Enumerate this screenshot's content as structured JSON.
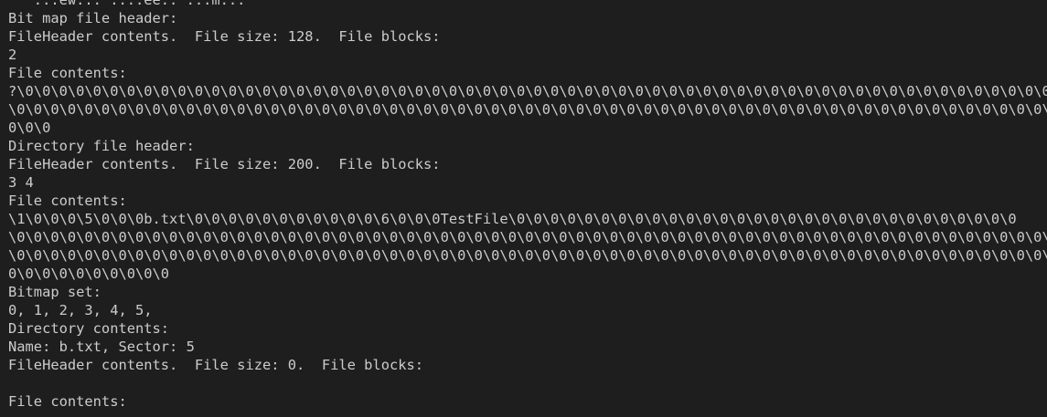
{
  "terminal": {
    "lines": [
      "   ...ew... ....ee.. ...m...",
      "Bit map file header:",
      "FileHeader contents.  File size: 128.  File blocks:",
      "2",
      "File contents:",
      "?\\0\\0\\0\\0\\0\\0\\0\\0\\0\\0\\0\\0\\0\\0\\0\\0\\0\\0\\0\\0\\0\\0\\0\\0\\0\\0\\0\\0\\0\\0\\0\\0\\0\\0\\0\\0\\0\\0\\0\\0\\0\\0\\0\\0\\0\\0\\0\\0\\0\\0\\0\\0\\0\\0\\0\\0\\0\\0\\0\\0\\0\\0",
      "\\0\\0\\0\\0\\0\\0\\0\\0\\0\\0\\0\\0\\0\\0\\0\\0\\0\\0\\0\\0\\0\\0\\0\\0\\0\\0\\0\\0\\0\\0\\0\\0\\0\\0\\0\\0\\0\\0\\0\\0\\0\\0\\0\\0\\0\\0\\0\\0\\0\\0\\0\\0\\0\\0\\0\\0\\0\\0\\0\\0\\0\\0\\",
      "0\\0\\0",
      "Directory file header:",
      "FileHeader contents.  File size: 200.  File blocks:",
      "3 4",
      "File contents:",
      "\\1\\0\\0\\0\\5\\0\\0\\0b.txt\\0\\0\\0\\0\\0\\0\\0\\0\\0\\0\\0\\6\\0\\0\\0TestFile\\0\\0\\0\\0\\0\\0\\0\\0\\0\\0\\0\\0\\0\\0\\0\\0\\0\\0\\0\\0\\0\\0\\0\\0\\0\\0\\0\\0\\0\\0",
      "\\0\\0\\0\\0\\0\\0\\0\\0\\0\\0\\0\\0\\0\\0\\0\\0\\0\\0\\0\\0\\0\\0\\0\\0\\0\\0\\0\\0\\0\\0\\0\\0\\0\\0\\0\\0\\0\\0\\0\\0\\0\\0\\0\\0\\0\\0\\0\\0\\0\\0\\0\\0\\0\\0\\0\\0\\0\\0\\0\\0\\0\\0\\0",
      "\\0\\0\\0\\0\\0\\0\\0\\0\\0\\0\\0\\0\\0\\0\\0\\0\\0\\0\\0\\0\\0\\0\\0\\0\\0\\0\\0\\0\\0\\0\\0\\0\\0\\0\\0\\0\\0\\0\\0\\0\\0\\0\\0\\0\\0\\0\\0\\0\\0\\0\\0\\0\\0\\0\\0\\0\\0\\0\\0\\0\\0\\0\\0\\",
      "0\\0\\0\\0\\0\\0\\0\\0\\0\\0",
      "Bitmap set:",
      "0, 1, 2, 3, 4, 5,",
      "Directory contents:",
      "Name: b.txt, Sector: 5",
      "FileHeader contents.  File size: 0.  File blocks:",
      "",
      "File contents:"
    ]
  }
}
